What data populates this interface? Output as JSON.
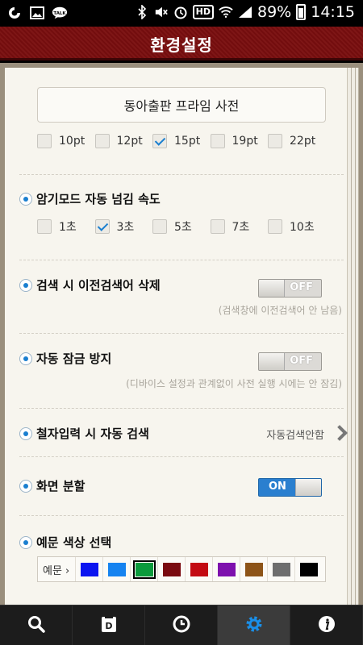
{
  "status_bar": {
    "battery": "89%",
    "time": "14:15",
    "hd": "HD",
    "talk": "TALK"
  },
  "header": {
    "title": "환경설정"
  },
  "font_select": {
    "value": "동아출판 프라임 사전"
  },
  "font_sizes": [
    {
      "label": "10pt",
      "checked": false
    },
    {
      "label": "12pt",
      "checked": false
    },
    {
      "label": "15pt",
      "checked": true
    },
    {
      "label": "19pt",
      "checked": false
    },
    {
      "label": "22pt",
      "checked": false
    }
  ],
  "memorize": {
    "title": "암기모드 자동 넘김 속도",
    "options": [
      {
        "label": "1초",
        "checked": false
      },
      {
        "label": "3초",
        "checked": true
      },
      {
        "label": "5초",
        "checked": false
      },
      {
        "label": "7초",
        "checked": false
      },
      {
        "label": "10초",
        "checked": false
      }
    ]
  },
  "delete_history": {
    "title": "검색 시 이전검색어 삭제",
    "toggle": "OFF",
    "hint": "(검색창에 이전검색어 안 남음)"
  },
  "auto_lock": {
    "title": "자동 잠금 방지",
    "toggle": "OFF",
    "hint": "(디바이스 설정과 관계없이 사전 실행 시에는 안 잠김)"
  },
  "spell_search": {
    "title": "철자입력 시 자동 검색",
    "value": "자동검색안함"
  },
  "split_screen": {
    "title": "화면 분할",
    "toggle": "ON"
  },
  "example_color": {
    "title": "예문 색상 선택",
    "label": "예문",
    "colors": [
      "#0b14f0",
      "#1683f0",
      "#0a9a3c",
      "#7a0a10",
      "#c30a12",
      "#7d10ad",
      "#8d5418",
      "#6e6e6e",
      "#000000"
    ],
    "selected_index": 2
  },
  "bottom_nav": [
    {
      "name": "search-icon",
      "active": false
    },
    {
      "name": "dictionary-icon",
      "active": false
    },
    {
      "name": "clock-icon",
      "active": false
    },
    {
      "name": "settings-icon",
      "active": true
    },
    {
      "name": "info-icon",
      "active": false
    }
  ]
}
